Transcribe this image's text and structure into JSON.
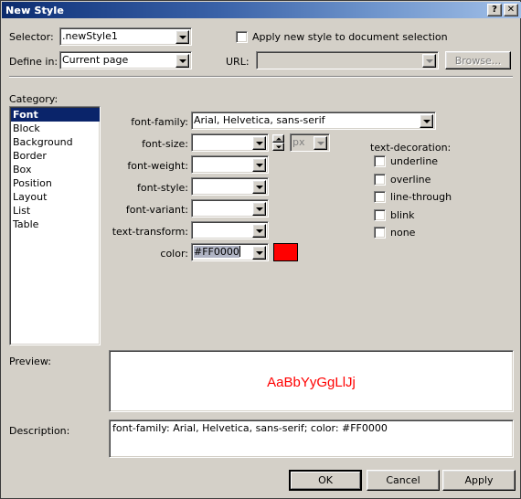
{
  "window": {
    "title": "New Style",
    "help_button": "?",
    "close_button": "✕"
  },
  "top": {
    "selector_label": "Selector:",
    "selector_value": ".newStyle1",
    "define_in_label": "Define in:",
    "define_in_value": "Current page",
    "apply_checkbox_label": "Apply new style to document selection",
    "apply_checkbox_checked": false,
    "url_label": "URL:",
    "url_value": "",
    "url_disabled": true,
    "browse_label": "Browse...",
    "browse_disabled": true
  },
  "category": {
    "label": "Category:",
    "selected": "Font",
    "items": [
      "Font",
      "Block",
      "Background",
      "Border",
      "Box",
      "Position",
      "Layout",
      "List",
      "Table"
    ]
  },
  "font_panel": {
    "font_family_label": "font-family:",
    "font_family_value": "Arial, Helvetica, sans-serif",
    "font_size_label": "font-size:",
    "font_size_value": "",
    "font_size_unit": "px",
    "font_size_unit_disabled": true,
    "font_weight_label": "font-weight:",
    "font_weight_value": "",
    "font_style_label": "font-style:",
    "font_style_value": "",
    "font_variant_label": "font-variant:",
    "font_variant_value": "",
    "text_transform_label": "text-transform:",
    "text_transform_value": "",
    "color_label": "color:",
    "color_value": "#FF0000",
    "color_swatch": "#FF0000"
  },
  "text_decoration": {
    "label": "text-decoration:",
    "options": [
      {
        "label": "underline",
        "checked": false
      },
      {
        "label": "overline",
        "checked": false
      },
      {
        "label": "line-through",
        "checked": false
      },
      {
        "label": "blink",
        "checked": false
      },
      {
        "label": "none",
        "checked": false
      }
    ]
  },
  "preview": {
    "label": "Preview:",
    "sample_text": "AaBbYyGgLlJj",
    "sample_color": "#FF0000"
  },
  "description": {
    "label": "Description:",
    "text": "font-family: Arial, Helvetica, sans-serif; color: #FF0000"
  },
  "footer": {
    "ok_label": "OK",
    "cancel_label": "Cancel",
    "apply_label": "Apply"
  }
}
